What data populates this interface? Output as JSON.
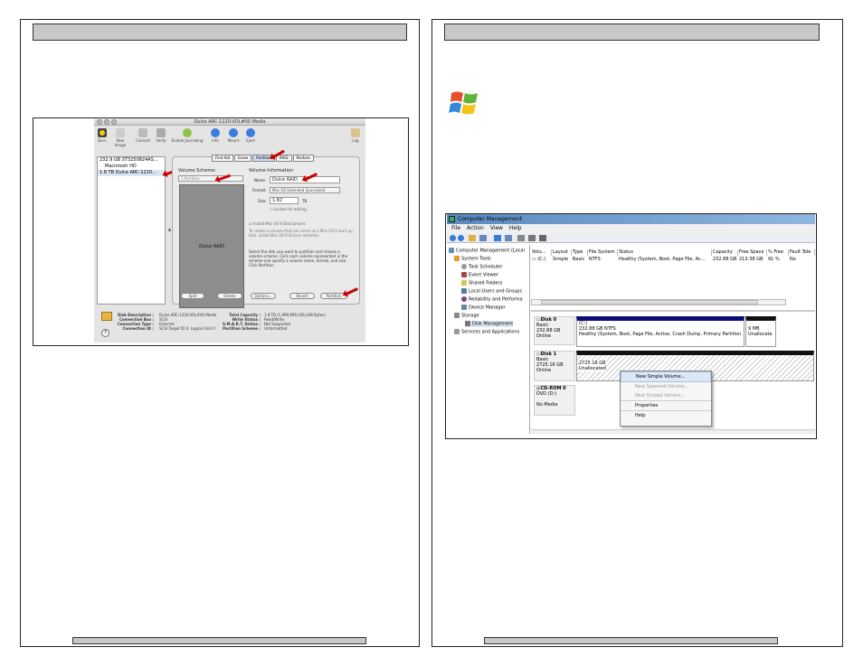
{
  "mac_window": {
    "title": "Dulce ARC-1220-VOL#00 Media",
    "toolbar": [
      "Burn",
      "New Image",
      "Convert",
      "Verify",
      "Enable Journaling",
      "Info",
      "Mount",
      "Eject",
      "Log"
    ],
    "disks": [
      "232.9 GB ST3250824AS...",
      "Macintosh HD",
      "1.8 TB Dulce ARC-1220..."
    ],
    "tabs": [
      "First Aid",
      "Erase",
      "Partition",
      "RAID",
      "Restore"
    ],
    "volume_scheme_label": "Volume Scheme:",
    "volume_scheme_value": "1 Partition",
    "volume_info_label": "Volume Information",
    "name_label": "Name:",
    "name_value": "Dulce RAID",
    "format_label": "Format:",
    "format_value": "Mac OS Extended (Journaled)",
    "size_label": "Size:",
    "size_value": "1.82",
    "size_unit": "TB",
    "locked_label": "Locked for editing",
    "install_label": "Install Mac OS 9 Disk Drivers",
    "install_note": "To create a volume that can serve as a Mac OS 9 start up disk, install Mac OS 9 Drivers installed.",
    "instructions": "Select the disk you want to partition and choose a volume scheme. Click each volume represented in the scheme and specify a volume name, format, and size. Click Partition.",
    "partition_block_label": "Dulce RAID",
    "buttons": [
      "Split",
      "Delete",
      "Options...",
      "Revert",
      "Partition"
    ],
    "info_left_labels": [
      "Disk Description :",
      "Connection Bus :",
      "Connection Type :",
      "Connection ID :"
    ],
    "info_left_values": [
      "Dulce ARC-1220-VOL#00 Media",
      "SCSI",
      "External",
      "SCSI Target ID 0, Logical Unit 0"
    ],
    "info_right_labels": [
      "Total Capacity :",
      "Write Status :",
      "S.M.A.R.T. Status :",
      "Partition Scheme :"
    ],
    "info_right_values": [
      "1.8 TB (1,999,999,336,448 Bytes)",
      "Read/Write",
      "Not Supported",
      "Unformatted"
    ],
    "help_glyph": "?"
  },
  "win_window": {
    "title": "Computer Management",
    "menu": [
      "File",
      "Action",
      "View",
      "Help"
    ],
    "tree": [
      "Computer Management (Local",
      "System Tools",
      "Task Scheduler",
      "Event Viewer",
      "Shared Folders",
      "Local Users and Groups",
      "Reliability and Performa",
      "Device Manager",
      "Storage",
      "Disk Management",
      "Services and Applications"
    ],
    "columns": [
      "Volu...",
      "Layout",
      "Type",
      "File System",
      "Status",
      "Capacity",
      "Free Space",
      "% Free",
      "Fault Tole"
    ],
    "row": [
      "(C:)",
      "Simple",
      "Basic",
      "NTFS",
      "Healthy (System, Boot, Page File, Ac...",
      "232.88 GB",
      "213.38 GB",
      "91 %",
      "No"
    ],
    "disk0": {
      "name": "Disk 0",
      "type": "Basic",
      "size": "232.88 GB",
      "status": "Online",
      "part_name": "(C:)",
      "part_size": "232.88 GB NTFS",
      "part_status": "Healthy (System, Boot, Page File, Active, Crash Dump, Primary Partition",
      "free_size": "9 MB",
      "free_status": "Unallocate"
    },
    "disk1": {
      "name": "Disk 1",
      "type": "Basic",
      "size": "2725.16 GB",
      "status": "Online",
      "part_size": "2725.16 GB",
      "part_status": "Unallocated"
    },
    "cdrom": {
      "name": "CD-ROM 0",
      "type": "DVD (D:)",
      "status": "No Media"
    },
    "context_menu": [
      "New Simple Volume...",
      "New Spanned Volume...",
      "New Striped Volume...",
      "Properties",
      "Help"
    ]
  },
  "colors": {
    "header_bar": "#c8c8c8",
    "win_partition_header": "#0b0b7a",
    "mac_arrow": "#cc0000"
  }
}
